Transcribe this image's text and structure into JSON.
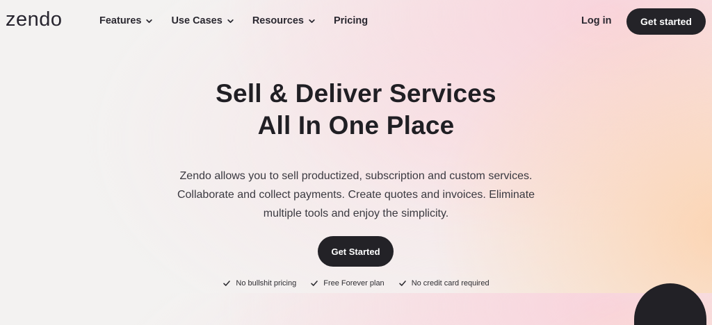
{
  "brand": {
    "logo_text": "zendo"
  },
  "nav": {
    "items": [
      {
        "label": "Features",
        "has_dropdown": true
      },
      {
        "label": "Use Cases",
        "has_dropdown": true
      },
      {
        "label": "Resources",
        "has_dropdown": true
      },
      {
        "label": "Pricing",
        "has_dropdown": false
      }
    ],
    "login_label": "Log in",
    "cta_label": "Get started"
  },
  "hero": {
    "title_line1": "Sell & Deliver Services",
    "title_line2": "All In One Place",
    "description_line1": "Zendo allows you to sell productized, subscription and custom services.",
    "description_line2": "Collaborate and collect payments. Create quotes and invoices. Eliminate",
    "description_line3": "multiple tools and enjoy the simplicity.",
    "cta_label": "Get Started"
  },
  "features": [
    {
      "label": "No bullshit pricing"
    },
    {
      "label": "Free Forever plan"
    },
    {
      "label": "No credit card required"
    }
  ],
  "colors": {
    "dark": "#242328",
    "accent_pink": "#f9d4dc",
    "accent_peach": "#fcd5b4",
    "background": "#f3f2f1"
  },
  "icons": {
    "chevron": "chevron-down-icon",
    "check": "check-icon"
  }
}
